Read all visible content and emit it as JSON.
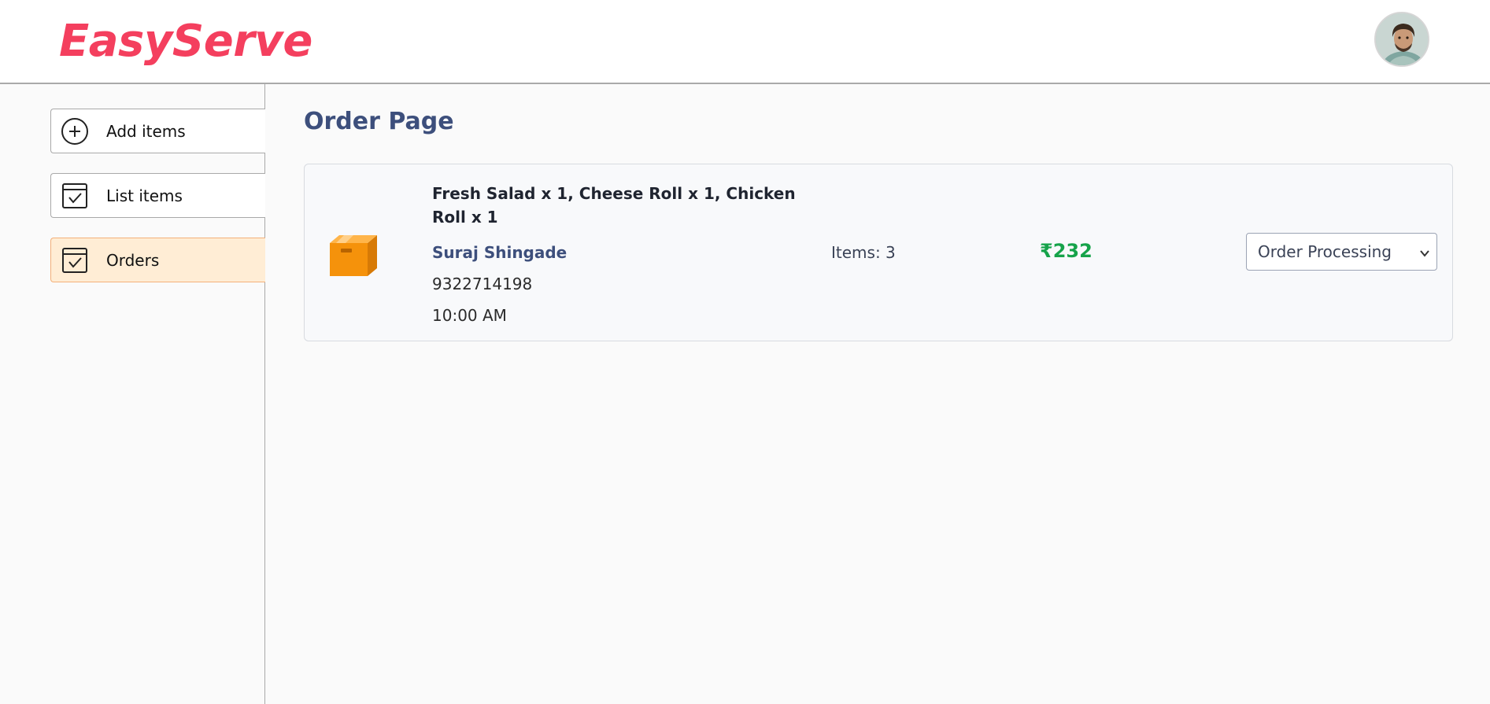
{
  "header": {
    "logo_text": "EasyServe",
    "avatar": "user-avatar"
  },
  "sidebar": {
    "items": [
      {
        "label": "Add items",
        "icon": "add-circle-icon",
        "active": false
      },
      {
        "label": "List items",
        "icon": "checklist-icon",
        "active": false
      },
      {
        "label": "Orders",
        "icon": "orders-check-icon",
        "active": true
      }
    ]
  },
  "main": {
    "title": "Order Page",
    "orders": [
      {
        "icon": "parcel-icon",
        "items_text": "Fresh Salad x 1, Cheese Roll x 1, Chicken Roll x 1",
        "customer_name": "Suraj Shingade",
        "phone": "9322714198",
        "time": "10:00 AM",
        "items_count": "Items: 3",
        "price": "₹232",
        "status": "Order Processing"
      }
    ]
  },
  "colors": {
    "brand": "#f43f5e",
    "title": "#3d4f7c",
    "price": "#16a34a",
    "active_bg": "#ffedd5"
  }
}
